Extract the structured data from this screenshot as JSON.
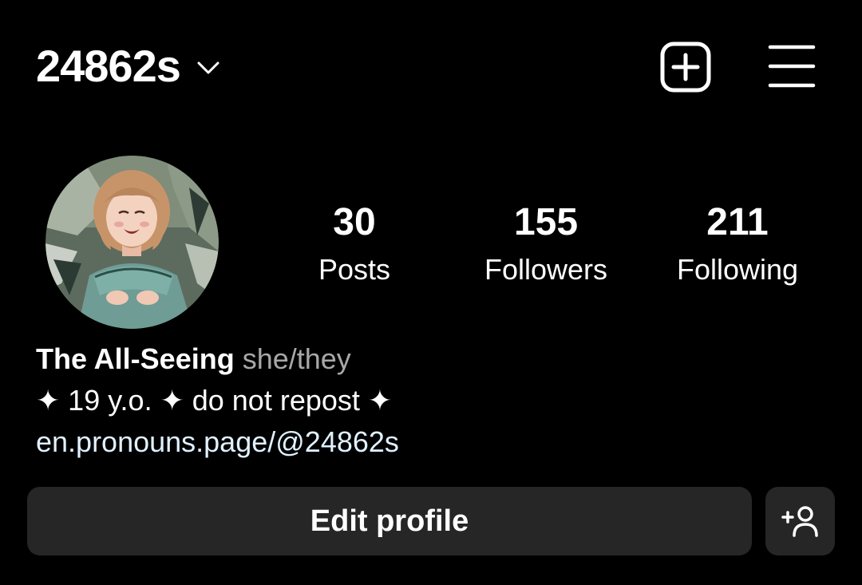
{
  "header": {
    "username": "24862s",
    "switcher_icon": "chevron-down-icon",
    "create_icon": "plus-square-icon",
    "menu_icon": "hamburger-menu-icon"
  },
  "profile": {
    "avatar_icon": "avatar",
    "stats": [
      {
        "value": "30",
        "label": "Posts"
      },
      {
        "value": "155",
        "label": "Followers"
      },
      {
        "value": "211",
        "label": "Following"
      }
    ],
    "display_name": "The All-Seeing",
    "pronouns": "she/they",
    "bio_text": "✦ 19 y.o. ✦ do not repost ✦",
    "link": "en.pronouns.page/@24862s"
  },
  "actions": {
    "edit_profile_label": "Edit profile",
    "add_person_icon": "add-person-icon"
  },
  "colors": {
    "background": "#000000",
    "text": "#ffffff",
    "secondary_text": "#a8a8a8",
    "link": "#e0f1ff",
    "button_bg": "#262626"
  }
}
